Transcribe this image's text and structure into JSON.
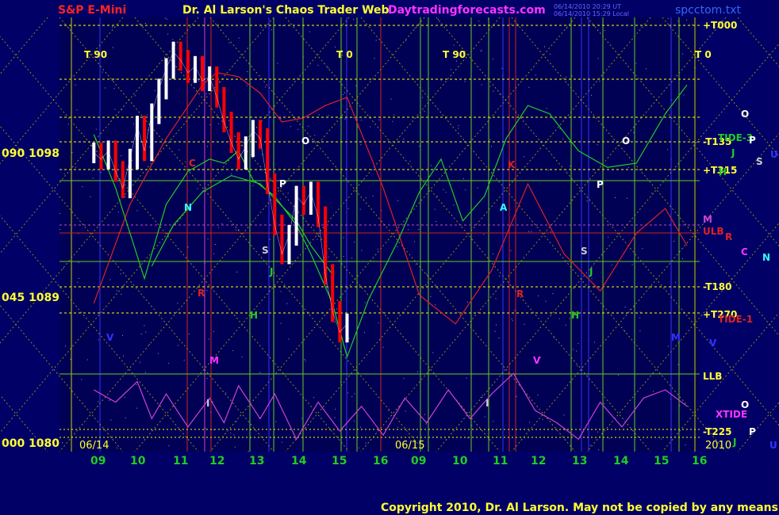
{
  "header": {
    "symbol": "S&P E-Mini",
    "title": "Dr. Al Larson's Chaos Trader Web",
    "site": "Daytradingforecasts.com",
    "timestamp_1": "06/14/2010 20:29 UT",
    "timestamp_2": "06/14/2010 15:29 Local",
    "file": "spcctom.txt"
  },
  "footer": {
    "copyright": "Copyright 2010, Dr. Al Larson. May not be copied by any means."
  },
  "colors": {
    "background": "#000066",
    "plot_bg": "#000055",
    "price_bar": "#ffffff",
    "down_bar": "#ff0000",
    "red_curve": "#dd2222",
    "green_curve": "#22cc22",
    "magenta_curve": "#cc44cc",
    "grid_green": "#66cc22",
    "grid_yellow": "#ffff00",
    "vline_red": "#cc2222",
    "vline_blue": "#3333ff",
    "vline_magenta": "#cc44cc",
    "title_red": "#ff2222",
    "title_yellow": "#ffff33",
    "title_magenta": "#ff33ff",
    "file_blue": "#3366ff"
  },
  "chart_data": {
    "type": "line",
    "title": "S&P E-Mini",
    "ylim": [
      1080,
      1100
    ],
    "y_ticks": [
      {
        "left": "090",
        "value": 1098,
        "label": "1098"
      },
      {
        "left": "045",
        "value": 1089,
        "label": "1089"
      },
      {
        "left": "000",
        "value": 1080,
        "label": "1080"
      }
    ],
    "date_labels": [
      "06/14",
      "06/15",
      "2010"
    ],
    "x_ticks": [
      "09",
      "10",
      "11",
      "12",
      "13",
      "14",
      "15",
      "16",
      "09",
      "10",
      "11",
      "12",
      "13",
      "14",
      "15",
      "16"
    ],
    "t_labels": [
      "T 90",
      "T 0",
      "T 90",
      "T 0"
    ],
    "right_labels": [
      "+T000",
      "-T135",
      "+T315",
      "M",
      "ULB",
      "-T180",
      "+T270",
      "LLB",
      "-T225"
    ],
    "side_labels": [
      "TIDE-3",
      "TIDE-1",
      "XTIDE",
      "O",
      "J",
      "H",
      "S",
      "U",
      "R",
      "C",
      "N",
      "V",
      "P",
      "O",
      "J",
      "P",
      "U"
    ],
    "plot_letters": [
      "O",
      "P",
      "N",
      "C",
      "S",
      "J",
      "R",
      "H",
      "V",
      "M",
      "O",
      "P",
      "A",
      "K",
      "S",
      "J",
      "R",
      "H",
      "M",
      "V",
      "I",
      "I"
    ],
    "price_series": {
      "name": "Price",
      "points": [
        [
          9.0,
          1094.5
        ],
        [
          9.2,
          1094.2
        ],
        [
          9.4,
          1094.6
        ],
        [
          9.6,
          1093.6
        ],
        [
          9.8,
          1092.8
        ],
        [
          10.0,
          1094.2
        ],
        [
          10.2,
          1095.8
        ],
        [
          10.4,
          1094.6
        ],
        [
          10.6,
          1096.4
        ],
        [
          10.8,
          1097.6
        ],
        [
          11.0,
          1098.6
        ],
        [
          11.2,
          1099.4
        ],
        [
          11.4,
          1099.0
        ],
        [
          11.6,
          1098.4
        ],
        [
          11.8,
          1098.7
        ],
        [
          12.0,
          1098.0
        ],
        [
          12.2,
          1098.2
        ],
        [
          12.4,
          1097.2
        ],
        [
          12.6,
          1096.0
        ],
        [
          12.8,
          1095.0
        ],
        [
          13.0,
          1094.2
        ],
        [
          13.2,
          1094.8
        ],
        [
          13.4,
          1095.6
        ],
        [
          13.6,
          1095.2
        ],
        [
          13.8,
          1093.0
        ],
        [
          14.0,
          1091.0
        ],
        [
          14.2,
          1089.6
        ],
        [
          14.4,
          1090.5
        ],
        [
          14.6,
          1092.4
        ],
        [
          14.8,
          1092.0
        ],
        [
          15.0,
          1092.6
        ],
        [
          15.2,
          1091.4
        ],
        [
          15.4,
          1088.6
        ],
        [
          15.6,
          1086.8
        ],
        [
          15.8,
          1085.8
        ],
        [
          16.0,
          1086.2
        ]
      ]
    },
    "curves": [
      {
        "name": "red",
        "points": [
          [
            9.0,
            1087.2
          ],
          [
            10.0,
            1092.0
          ],
          [
            11.0,
            1095.2
          ],
          [
            12.0,
            1097.8
          ],
          [
            12.4,
            1098.4
          ],
          [
            13.0,
            1098.2
          ],
          [
            13.6,
            1097.4
          ],
          [
            14.2,
            1096.0
          ],
          [
            14.8,
            1096.2
          ],
          [
            15.4,
            1096.8
          ],
          [
            16.0,
            1097.2
          ],
          [
            17.0,
            1092.8
          ],
          [
            18.0,
            1087.6
          ],
          [
            19.0,
            1086.2
          ],
          [
            20.0,
            1088.8
          ],
          [
            21.0,
            1093.0
          ],
          [
            22.0,
            1089.6
          ],
          [
            23.0,
            1087.8
          ],
          [
            24.0,
            1090.6
          ],
          [
            24.8,
            1091.8
          ],
          [
            25.4,
            1090.0
          ]
        ]
      },
      {
        "name": "green",
        "points": [
          [
            9.0,
            1095.4
          ],
          [
            9.6,
            1092.8
          ],
          [
            10.4,
            1088.4
          ],
          [
            11.0,
            1092.0
          ],
          [
            11.6,
            1093.6
          ],
          [
            12.2,
            1094.2
          ],
          [
            12.6,
            1094.0
          ],
          [
            13.0,
            1094.6
          ],
          [
            13.4,
            1093.2
          ],
          [
            14.0,
            1092.4
          ],
          [
            14.6,
            1091.0
          ],
          [
            15.0,
            1089.6
          ],
          [
            15.6,
            1087.2
          ],
          [
            16.0,
            1084.6
          ],
          [
            16.6,
            1087.4
          ],
          [
            17.4,
            1090.2
          ],
          [
            18.0,
            1092.6
          ],
          [
            18.6,
            1094.2
          ],
          [
            19.2,
            1091.2
          ],
          [
            19.8,
            1092.4
          ],
          [
            20.4,
            1095.2
          ],
          [
            21.0,
            1096.8
          ],
          [
            21.6,
            1096.4
          ],
          [
            22.4,
            1094.6
          ],
          [
            23.2,
            1093.8
          ],
          [
            24.0,
            1094.0
          ],
          [
            24.8,
            1096.4
          ],
          [
            25.4,
            1097.8
          ]
        ]
      },
      {
        "name": "green-2",
        "points": [
          [
            10.6,
            1089.0
          ],
          [
            11.2,
            1091.0
          ],
          [
            12.0,
            1092.6
          ],
          [
            12.8,
            1093.4
          ],
          [
            13.6,
            1093.0
          ],
          [
            14.6,
            1091.2
          ],
          [
            15.0,
            1090.0
          ],
          [
            15.6,
            1088.6
          ]
        ]
      },
      {
        "name": "xtide",
        "points": [
          [
            9.0,
            1083.0
          ],
          [
            9.6,
            1082.4
          ],
          [
            10.2,
            1083.4
          ],
          [
            10.6,
            1081.6
          ],
          [
            11.0,
            1082.8
          ],
          [
            11.6,
            1081.2
          ],
          [
            12.2,
            1082.6
          ],
          [
            12.6,
            1081.4
          ],
          [
            13.0,
            1083.2
          ],
          [
            13.6,
            1081.6
          ],
          [
            14.0,
            1082.8
          ],
          [
            14.6,
            1080.6
          ],
          [
            15.2,
            1082.4
          ],
          [
            15.8,
            1081.0
          ],
          [
            16.4,
            1082.2
          ],
          [
            17.0,
            1080.8
          ],
          [
            17.6,
            1082.6
          ],
          [
            18.2,
            1081.4
          ],
          [
            18.8,
            1083.0
          ],
          [
            19.4,
            1081.6
          ],
          [
            20.0,
            1082.8
          ],
          [
            20.6,
            1083.8
          ],
          [
            21.2,
            1082.0
          ],
          [
            21.8,
            1081.4
          ],
          [
            22.4,
            1080.6
          ],
          [
            23.0,
            1082.4
          ],
          [
            23.6,
            1081.2
          ],
          [
            24.2,
            1082.6
          ],
          [
            24.8,
            1083.0
          ],
          [
            25.4,
            1082.2
          ]
        ]
      }
    ]
  }
}
